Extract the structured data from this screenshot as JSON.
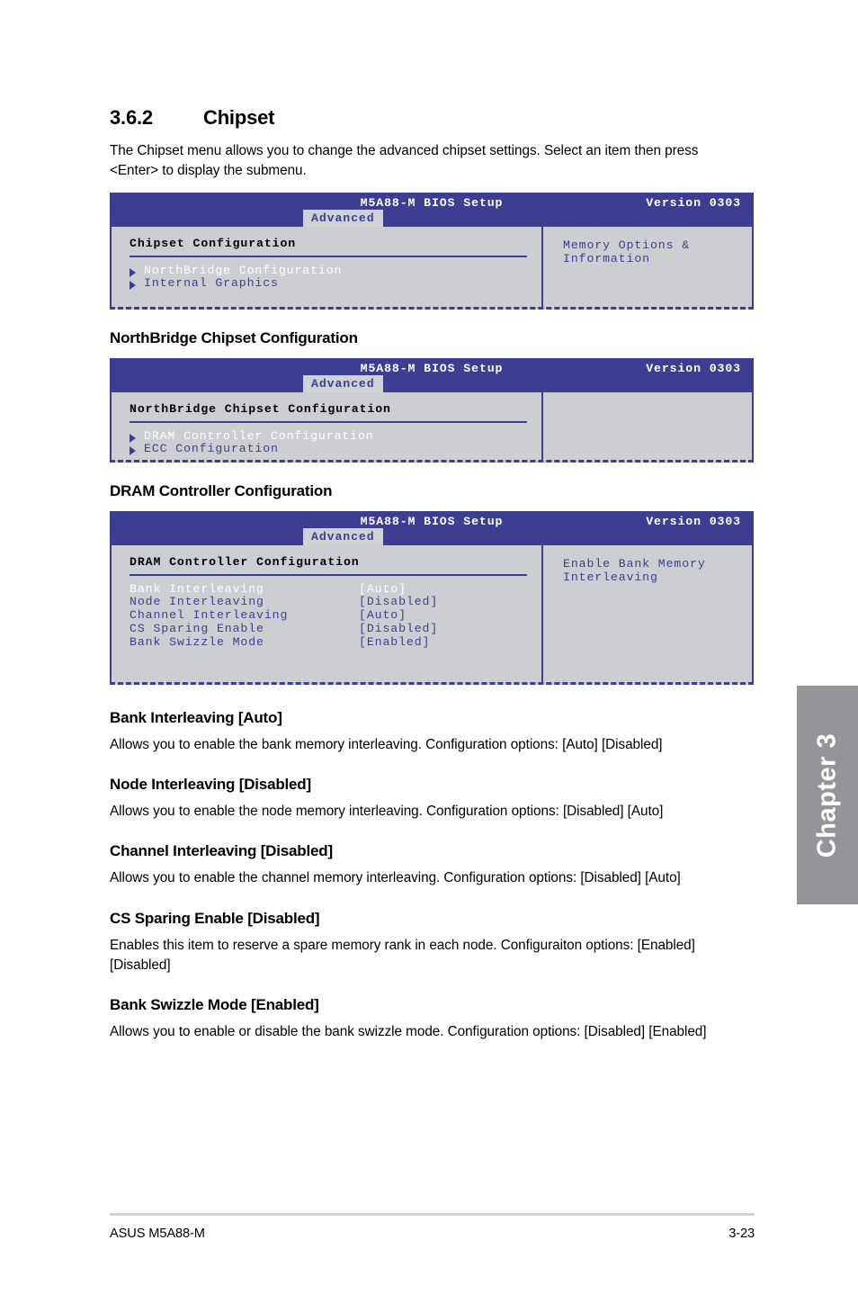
{
  "section": {
    "number": "3.6.2",
    "title": "Chipset",
    "intro": "The Chipset menu allows you to change the advanced chipset settings. Select an item then press <Enter> to display the submenu."
  },
  "bios_common": {
    "title": "M5A88-M BIOS Setup",
    "version": "Version 0303",
    "tab": "Advanced"
  },
  "screens": [
    {
      "panel_heading": "Chipset Configuration",
      "items": [
        {
          "label": "NorthBridge Configuration",
          "selected": true
        },
        {
          "label": "Internal Graphics",
          "selected": false
        }
      ],
      "help": [
        "Memory Options &",
        "Information"
      ]
    },
    {
      "heading": "NorthBridge Chipset Configuration",
      "panel_heading": "NorthBridge Chipset Configuration",
      "items": [
        {
          "label": "DRAM Controller Configuration",
          "selected": true
        },
        {
          "label": "ECC Configuration",
          "selected": false
        }
      ],
      "help": []
    },
    {
      "heading": "DRAM Controller Configuration",
      "panel_heading": "DRAM Controller Configuration",
      "options": [
        {
          "name": "Bank Interleaving",
          "value": "[Auto]",
          "selected": true
        },
        {
          "name": "Node Interleaving",
          "value": "[Disabled]",
          "selected": false
        },
        {
          "name": "Channel Interleaving",
          "value": "[Auto]",
          "selected": false
        },
        {
          "name": "CS Sparing Enable",
          "value": "[Disabled]",
          "selected": false
        },
        {
          "name": "Bank Swizzle Mode",
          "value": "[Enabled]",
          "selected": false
        }
      ],
      "help": [
        "Enable Bank Memory",
        "Interleaving"
      ]
    }
  ],
  "descriptions": [
    {
      "title": "Bank Interleaving [Auto]",
      "text": "Allows you to enable the bank memory interleaving. Configuration options: [Auto] [Disabled]"
    },
    {
      "title": "Node Interleaving [Disabled]",
      "text": "Allows you to enable the node memory interleaving. Configuration options: [Disabled] [Auto]"
    },
    {
      "title": "Channel Interleaving [Disabled]",
      "text": "Allows you to enable the channel memory interleaving. Configuration options: [Disabled] [Auto]"
    },
    {
      "title": "CS Sparing Enable [Disabled]",
      "text": "Enables this item to reserve a spare memory rank in each node. Configuraiton options: [Enabled] [Disabled]"
    },
    {
      "title": "Bank Swizzle Mode [Enabled]",
      "text": "Allows you to enable or disable the bank swizzle mode. Configuration options: [Disabled] [Enabled]"
    }
  ],
  "chapter_tab": {
    "label": "Chapter 3"
  },
  "footer": {
    "left": "ASUS M5A88-M",
    "right": "3-23"
  },
  "colors": {
    "bios_header_blue": "#3c3e92",
    "bios_panel_gray": "#cdced1",
    "bios_tab_gray": "#d0d1d4",
    "chapter_tab_gray": "#939598",
    "footer_rule_gray": "#d2d3d5"
  }
}
